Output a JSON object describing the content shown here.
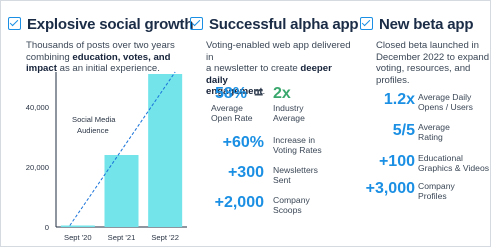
{
  "columns": {
    "social": {
      "title": "Explosive social growth",
      "desc_1": "Thousands of posts over two years",
      "desc_2a": "combining ",
      "desc_2b": "education, votes, and",
      "desc_3a": "impact",
      "desc_3b": " as an initial experience."
    },
    "alpha": {
      "title": "Successful alpha app",
      "desc_1": "Voting-enabled web app delivered in",
      "desc_2a": "a newsletter to create ",
      "desc_2b": "deeper daily",
      "desc_3": "engagement",
      "desc_3b": "."
    },
    "beta": {
      "title": "New beta app",
      "desc_1": "Closed beta launched in",
      "desc_2": "December 2022 to expand",
      "desc_3": "voting, resources, and profiles."
    }
  },
  "chart_data": {
    "type": "bar",
    "categories": [
      "Sept '20",
      "Sept '21",
      "Sept '22"
    ],
    "values": [
      500,
      24000,
      51000
    ],
    "yticks": [
      "0",
      "20,000",
      "40,000"
    ],
    "ytick_values": [
      0,
      20000,
      40000
    ],
    "ylim": [
      0,
      51000
    ],
    "bar_color": "#72e4ea",
    "trend_color": "#1a73d9",
    "annotation_1": "Social Media",
    "annotation_2": "Audience"
  },
  "alpha_metrics": {
    "open_rate": {
      "value": "58%",
      "label_1": "Average",
      "label_2": "Open Rate"
    },
    "equals": "=",
    "industry": {
      "value": "2x",
      "label_1": "Industry",
      "label_2": "Average"
    },
    "voting": {
      "value": "+60%",
      "label_1": "Increase in",
      "label_2": "Voting Rates"
    },
    "newsletters": {
      "value": "+300",
      "label_1": "Newsletters",
      "label_2": "Sent"
    },
    "scoops": {
      "value": "+2,000",
      "label_1": "Company",
      "label_2": "Scoops"
    }
  },
  "beta_metrics": {
    "ratio": {
      "value": "1.2x",
      "label_1": "Average Daily",
      "label_2": "Opens / Users"
    },
    "rating": {
      "value": "5/5",
      "label_1": "Average",
      "label_2": "Rating"
    },
    "graphics": {
      "value": "+100",
      "label_1": "Educational",
      "label_2": "Graphics & Videos"
    },
    "profiles": {
      "value": "+3,000",
      "label_1": "Company",
      "label_2": "Profiles"
    }
  },
  "colors": {
    "accent": "#1a8fe3",
    "green": "#3aa76d",
    "heading": "#1b2c46"
  },
  "icons": [
    "checkbox-icon"
  ]
}
